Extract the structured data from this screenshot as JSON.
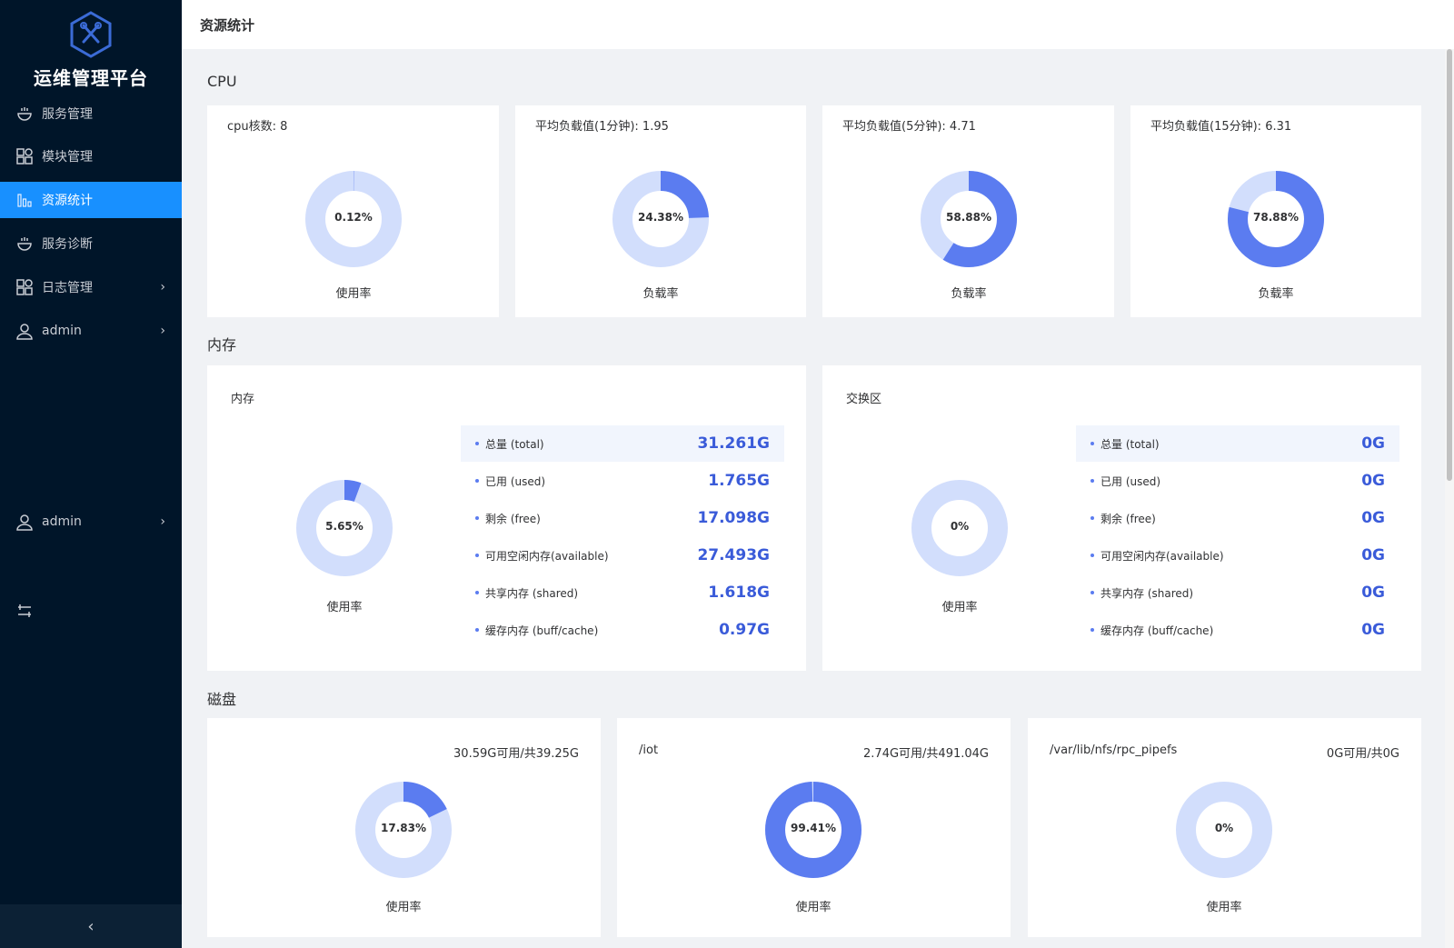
{
  "app": {
    "title": "运维管理平台"
  },
  "sidebar": {
    "items": [
      {
        "label": "服务管理",
        "icon": "service-icon"
      },
      {
        "label": "模块管理",
        "icon": "grid-icon"
      },
      {
        "label": "资源统计",
        "icon": "bar-chart-icon",
        "active": true
      },
      {
        "label": "服务诊断",
        "icon": "service-icon"
      },
      {
        "label": "日志管理",
        "icon": "grid-icon",
        "chevron": true
      },
      {
        "label": "admin",
        "icon": "user-icon",
        "chevron": true
      },
      {
        "label": "admin",
        "icon": "user-icon",
        "chevron": true
      }
    ]
  },
  "header": {
    "title": "资源统计"
  },
  "colors": {
    "primary": "#1890ff",
    "donut_fill": "#5b7cf0",
    "donut_track": "#d2defc",
    "sidebar_bg": "#001529"
  },
  "sections": {
    "cpu": "CPU",
    "memory": "内存",
    "disk": "磁盘"
  },
  "cpu_cards": [
    {
      "head": "cpu核数:  8",
      "percent": "0.12%",
      "value": 0.0012,
      "caption": "使用率"
    },
    {
      "head": "平均负载值(1分钟):  1.95",
      "percent": "24.38%",
      "value": 0.2438,
      "caption": "负载率"
    },
    {
      "head": "平均负载值(5分钟):  4.71",
      "percent": "58.88%",
      "value": 0.5888,
      "caption": "负载率"
    },
    {
      "head": "平均负载值(15分钟):  6.31",
      "percent": "78.88%",
      "value": 0.7888,
      "caption": "负载率"
    }
  ],
  "memory_cards": [
    {
      "head": "内存",
      "percent": "5.65%",
      "value": 0.0565,
      "caption": "使用率",
      "rows": [
        {
          "label": "总量 (total)",
          "value": "31.261G"
        },
        {
          "label": "已用 (used)",
          "value": "1.765G"
        },
        {
          "label": "剩余 (free)",
          "value": "17.098G"
        },
        {
          "label": "可用空闲内存(available)",
          "value": "27.493G"
        },
        {
          "label": "共享内存 (shared)",
          "value": "1.618G"
        },
        {
          "label": "缓存内存 (buff/cache)",
          "value": "0.97G"
        }
      ]
    },
    {
      "head": "交换区",
      "percent": "0%",
      "value": 0,
      "caption": "使用率",
      "rows": [
        {
          "label": "总量 (total)",
          "value": "0G"
        },
        {
          "label": "已用 (used)",
          "value": "0G"
        },
        {
          "label": "剩余 (free)",
          "value": "0G"
        },
        {
          "label": "可用空闲内存(available)",
          "value": "0G"
        },
        {
          "label": "共享内存 (shared)",
          "value": "0G"
        },
        {
          "label": "缓存内存 (buff/cache)",
          "value": "0G"
        }
      ]
    }
  ],
  "disk_cards": [
    {
      "path": "",
      "info": "30.59G可用/共39.25G",
      "percent": "17.83%",
      "value": 0.1783,
      "caption": "使用率"
    },
    {
      "path": "/iot",
      "info": "2.74G可用/共491.04G",
      "percent": "99.41%",
      "value": 0.9941,
      "caption": "使用率"
    },
    {
      "path": "/var/lib/nfs/rpc_pipefs",
      "info": "0G可用/共0G",
      "percent": "0%",
      "value": 0,
      "caption": "使用率"
    }
  ]
}
